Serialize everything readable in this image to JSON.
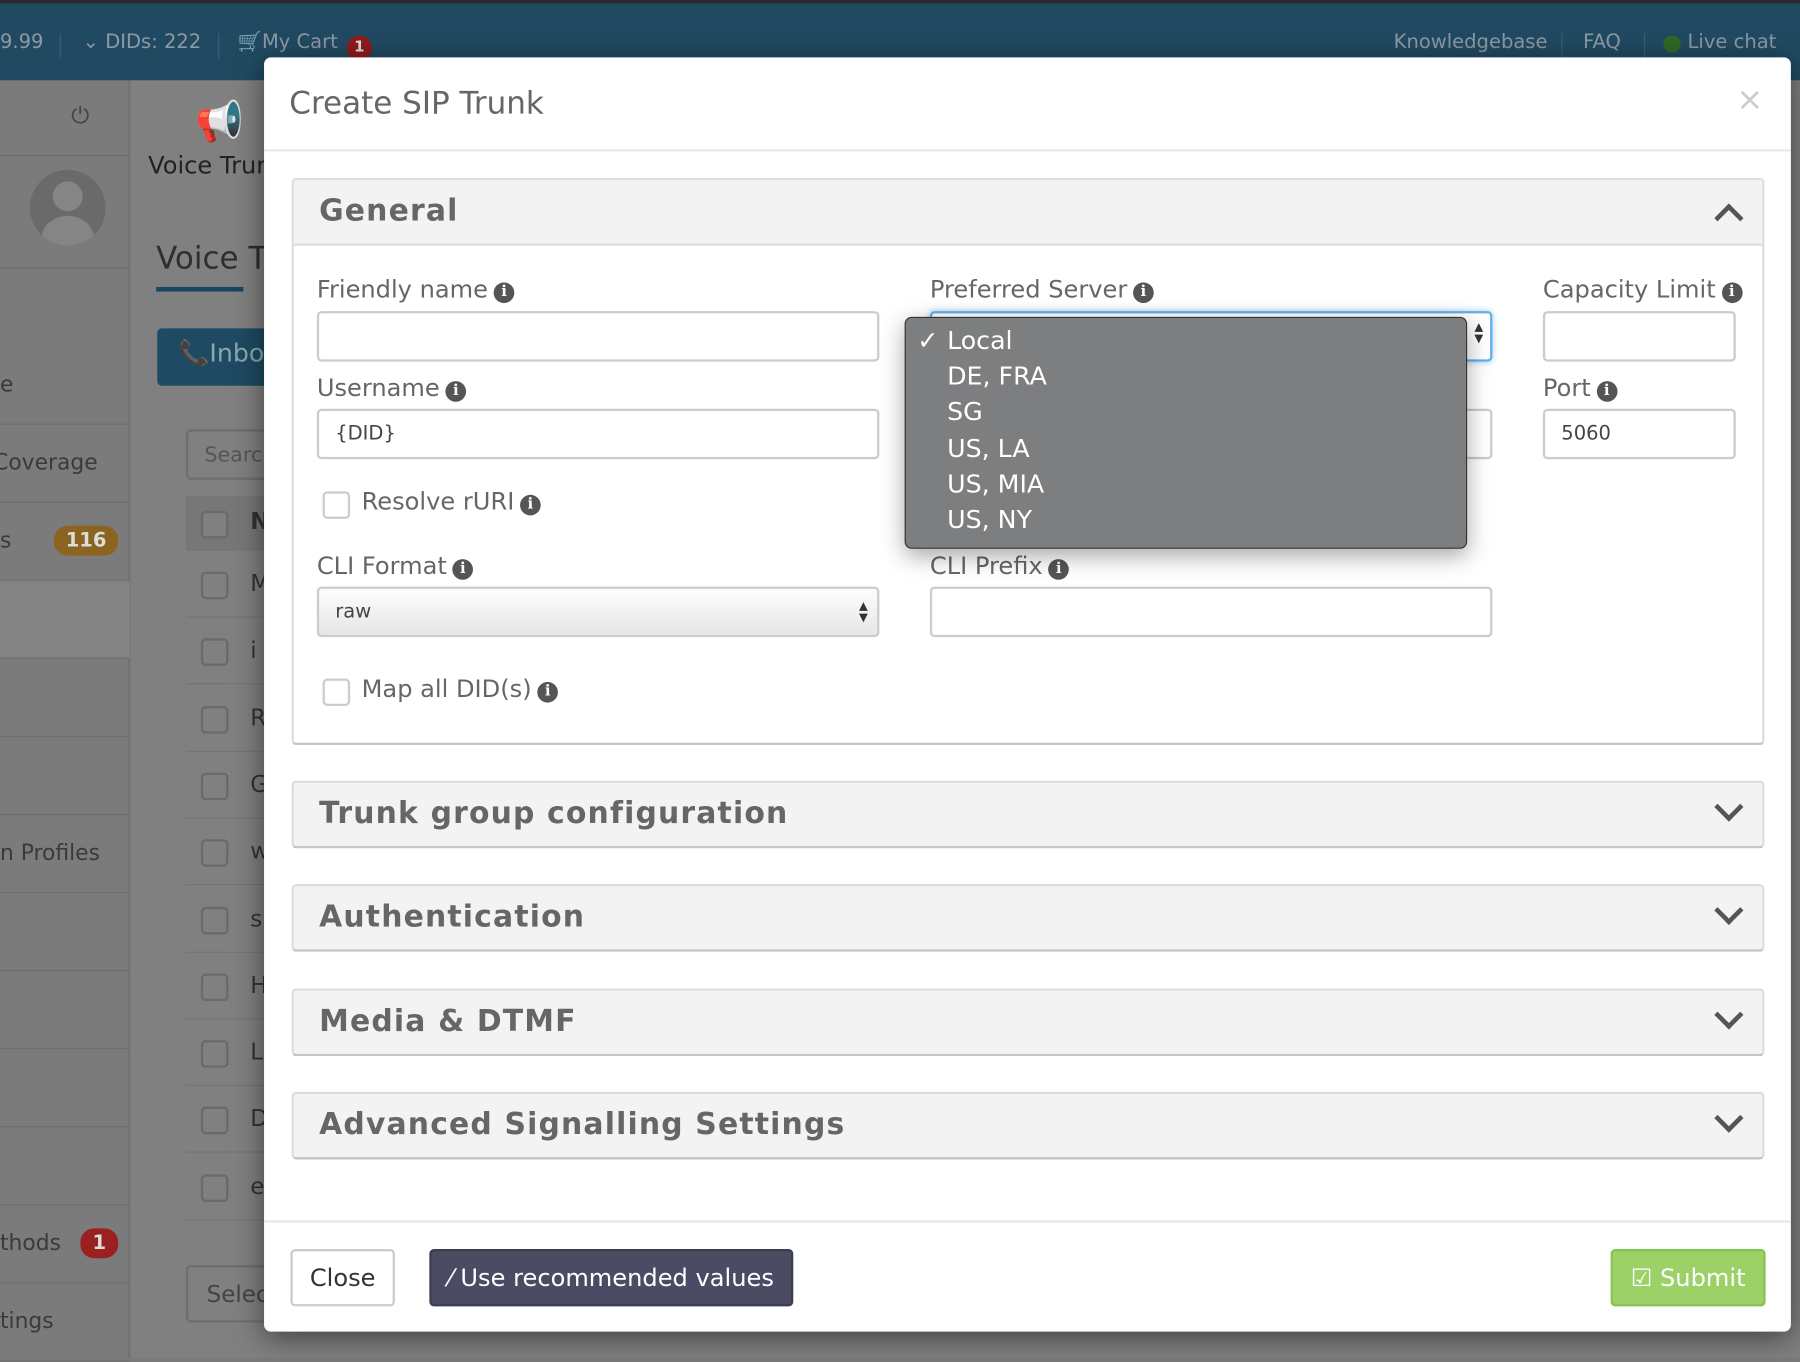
{
  "topbar": {
    "balance": "9.99",
    "dids": "DIDs: 222",
    "cart": "My Cart",
    "cart_count": "1",
    "links": [
      "Knowledgebase",
      "FAQ",
      "Live chat"
    ]
  },
  "sidebar": {
    "items": [
      "e",
      "Coverage",
      "s",
      "n Profiles",
      "thods",
      "tings"
    ],
    "badge_116": "116",
    "badge_1": "1"
  },
  "content": {
    "header": "Voice Trun",
    "page_title": "Voice Tr",
    "inbound_btn": "Inbo",
    "search_placeholder": "Search",
    "table_first_letters": [
      "N",
      "M",
      "i",
      "R",
      "G",
      "w",
      "s",
      "H",
      "L",
      "D",
      "e"
    ],
    "select": "Selec"
  },
  "modal": {
    "title": "Create SIP Trunk",
    "general": {
      "title": "General",
      "friendly_name_label": "Friendly name",
      "friendly_name_value": "",
      "preferred_server_label": "Preferred Server",
      "preferred_server_options": [
        "Local",
        "DE, FRA",
        "SG",
        "US, LA",
        "US, MIA",
        "US, NY"
      ],
      "preferred_server_selected": "Local",
      "capacity_label": "Capacity Limit",
      "capacity_value": "",
      "username_label": "Username",
      "username_value": "{DID}",
      "port_label": "Port",
      "port_value": "5060",
      "resolve_label": "Resolve rURI",
      "resolve_checked": false,
      "cli_format_label": "CLI Format",
      "cli_format_value": "raw",
      "cli_prefix_label": "CLI Prefix",
      "cli_prefix_value": "",
      "map_label": "Map all DID(s)",
      "map_checked": false
    },
    "sections": [
      "Trunk group configuration",
      "Authentication",
      "Media & DTMF",
      "Advanced Signalling Settings"
    ],
    "footer": {
      "close": "Close",
      "recommended": "Use recommended values",
      "submit": "Submit"
    }
  },
  "colors": {
    "topbar": "#214a62",
    "submit": "#9bd166",
    "recommended": "#4b4b63",
    "badge_warning": "#8a6420",
    "badge_danger": "#9b2020"
  }
}
